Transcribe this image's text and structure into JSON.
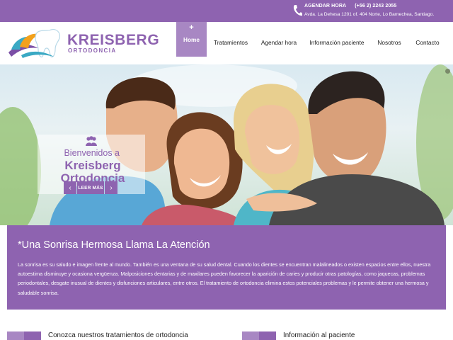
{
  "topbar": {
    "agendar_label": "AGENDAR HORA",
    "phone": "(+56 2) 2243 2055",
    "address": "Avda. La Dehesa 1201 of. 404 Norte, Lo Barnechea, Santiago.",
    "icon": "phone-icon"
  },
  "logo": {
    "name": "KREISBERG",
    "subtitle": "ORTODONCIA",
    "icon": "tooth-logo-icon"
  },
  "nav": {
    "items": [
      {
        "label": "Home",
        "active": true,
        "plus": "+"
      },
      {
        "label": "Tratamientos"
      },
      {
        "label": "Agendar hora"
      },
      {
        "label": "Información paciente"
      },
      {
        "label": "Nosotros"
      },
      {
        "label": "Contacto"
      }
    ]
  },
  "hero": {
    "welcome_line1": "Bienvenidos a",
    "welcome_line2": "Kreisberg",
    "welcome_line3": "Ortodoncia",
    "read_more": "LEER MÁS",
    "prev": "‹",
    "next": "›"
  },
  "band": {
    "title": "*Una Sonrisa Hermosa Llama La Atención",
    "text": "La sonrisa es su saludo e imagen frente al mundo. También es una ventana de su salud dental. Cuando los dientes se encuentran malalineados o existen espacios entre ellos, nuestra autoestima disminuye y ocasiona vergüenza. Malposiciones dentarias y de maxilares pueden favorecer la aparición de caries y producir otras patologías, como jaquecas, problemas periodontales, desgate inusual de dientes y disfunciones articulares, entre otros. El tratamiento de ortodoncia elimina estos potenciales problemas y le permite obtener una hermosa y saludable sonrisa."
  },
  "sections": {
    "left_title": "Conozca nuestros tratamientos de ortodoncia",
    "right_title": "Información al paciente"
  },
  "colors": {
    "brand_purple": "#8e63b0",
    "active_nav": "#a887c3",
    "logo_orange": "#f3a11b",
    "logo_teal": "#3aa9c4"
  }
}
